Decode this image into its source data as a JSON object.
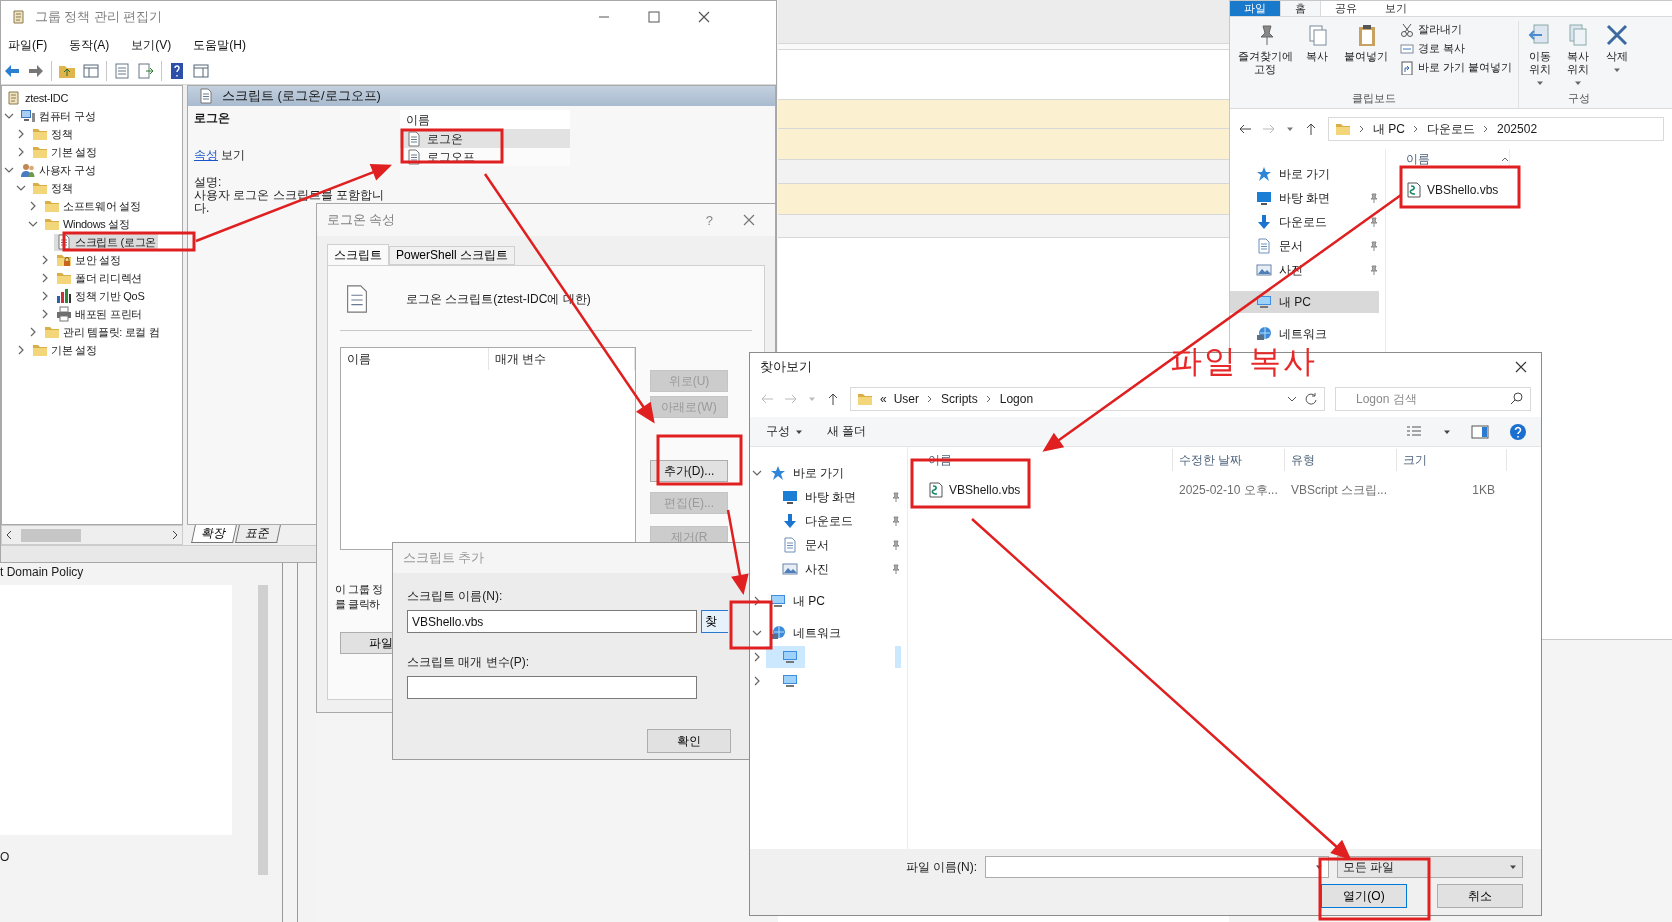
{
  "gpe": {
    "title": "그룹 정책 관리 편집기",
    "menu": [
      "파일(F)",
      "동작(A)",
      "보기(V)",
      "도움말(H)"
    ],
    "tree_root": {
      "label": "ztest-IDC",
      "selected": false
    },
    "tree": [
      {
        "label": "컴퓨터 구성",
        "kind": "computer",
        "expanded": true,
        "selected": false,
        "children": [
          {
            "label": "정책",
            "kind": "folder",
            "expanded": false,
            "selected": false
          },
          {
            "label": "기본 설정",
            "kind": "folder",
            "expanded": false,
            "selected": false
          }
        ]
      },
      {
        "label": "사용자 구성",
        "kind": "users",
        "expanded": true,
        "selected": false,
        "children": [
          {
            "label": "정책",
            "kind": "folder",
            "expanded": true,
            "selected": false,
            "children": [
              {
                "label": "소프트웨어 설정",
                "kind": "folder",
                "expanded": false,
                "selected": false
              },
              {
                "label": "Windows 설정",
                "kind": "folder",
                "expanded": true,
                "selected": false,
                "children": [
                  {
                    "label": "스크립트 (로그온",
                    "kind": "script",
                    "selected": true
                  },
                  {
                    "label": "보안 설정",
                    "kind": "security",
                    "expanded": false,
                    "selected": false
                  },
                  {
                    "label": "폴더 리디렉션",
                    "kind": "folder",
                    "expanded": false,
                    "selected": false
                  },
                  {
                    "label": "정책 기반 QoS",
                    "kind": "qos",
                    "expanded": false,
                    "selected": false
                  },
                  {
                    "label": "배포된 프린터",
                    "kind": "printer",
                    "expanded": false,
                    "selected": false
                  }
                ]
              },
              {
                "label": "관리 템플릿: 로컬 컴",
                "kind": "folder",
                "expanded": false,
                "selected": false
              }
            ]
          },
          {
            "label": "기본 설정",
            "kind": "folder",
            "expanded": false,
            "selected": false
          }
        ]
      }
    ],
    "pane": {
      "header": "스크립트 (로그온/로그오프)",
      "heading": "로그온",
      "link": "속성",
      "link_suffix": "보기",
      "description_label": "설명:",
      "description": [
        "사용자 로그온 스크립트를 포함합니",
        "다."
      ],
      "list_column": "이름",
      "list_items": [
        {
          "label": "로그온",
          "selected": true
        },
        {
          "label": "로그오프",
          "selected": false
        }
      ]
    },
    "view_tabs": [
      {
        "label": "확장",
        "selected": true
      },
      {
        "label": "표준",
        "selected": false
      }
    ]
  },
  "backdrop": {
    "title": "t Domain Policy",
    "footer": "O"
  },
  "logon_dialog": {
    "title": "로그온 속성",
    "help": "?",
    "tabs": [
      {
        "label": "스크립트",
        "selected": true
      },
      {
        "label": "PowerShell 스크립트",
        "selected": false
      }
    ],
    "heading": "로그온 스크립트(ztest-IDC에 대한)",
    "columns": [
      "이름",
      "매개 변수"
    ],
    "buttons": [
      {
        "label": "위로(U)",
        "disabled": true
      },
      {
        "label": "아래로(W)",
        "disabled": true
      },
      {
        "label": "추가(D)...",
        "disabled": false
      },
      {
        "label": "편집(E)...",
        "disabled": true
      },
      {
        "label": "제거(R",
        "disabled": true
      }
    ],
    "note": [
      "이 그룹 정",
      "를 클릭하"
    ],
    "files_button": "파일"
  },
  "add_dialog": {
    "title": "스크립트 추가",
    "name_label": "스크립트 이름(N):",
    "name_value": "VBShello.vbs",
    "browse_button": "찾",
    "params_label": "스크립트 매개 변수(P):",
    "ok_button": "확인"
  },
  "browse_dialog": {
    "title": "찾아보기",
    "path_prefix": "«",
    "path": [
      "User",
      "Scripts",
      "Logon"
    ],
    "search_placeholder": "Logon 검색",
    "toolbar": [
      {
        "label": "구성",
        "menu": true
      },
      {
        "label": "새 폴더",
        "menu": false
      }
    ],
    "nav": [
      {
        "label": "바로 가기",
        "kind": "star",
        "expanded": true,
        "selected": false,
        "pinned": false,
        "children": [
          {
            "label": "바탕 화면",
            "kind": "desktop",
            "selected": false,
            "pinned": true
          },
          {
            "label": "다운로드",
            "kind": "download",
            "selected": false,
            "pinned": true
          },
          {
            "label": "문서",
            "kind": "document",
            "selected": false,
            "pinned": true
          },
          {
            "label": "사진",
            "kind": "pictures",
            "selected": false,
            "pinned": true
          }
        ]
      },
      {
        "label": "내 PC",
        "kind": "pc",
        "expanded": false,
        "selected": false,
        "pinned": false
      },
      {
        "label": "네트워크",
        "kind": "network",
        "expanded": true,
        "selected": false,
        "pinned": false,
        "children": [
          {
            "kind": "pc",
            "expanded": false,
            "selected": true,
            "pinned": false
          },
          {
            "kind": "pc",
            "expanded": false,
            "selected": false,
            "pinned": false
          }
        ]
      }
    ],
    "columns": [
      "이름",
      "수정한 날짜",
      "유형",
      "크기"
    ],
    "files": [
      {
        "name": "VBShello.vbs",
        "date": "2025-02-10 오후...",
        "type": "VBScript 스크립...",
        "size": "1KB"
      }
    ],
    "filename_label": "파일 이름(N):",
    "filter": "모든 파일",
    "buttons": [
      {
        "label": "열기(O)",
        "default": true
      },
      {
        "label": "취소",
        "default": false
      }
    ]
  },
  "explorer": {
    "ribbon_tabs": [
      {
        "label": "파일",
        "kind": "file",
        "selected": false
      },
      {
        "label": "홈",
        "kind": "tab",
        "selected": true
      },
      {
        "label": "공유",
        "kind": "tab",
        "selected": false
      },
      {
        "label": "보기",
        "kind": "tab",
        "selected": false
      }
    ],
    "clipboard": {
      "large": [
        {
          "label": "즐겨찾기에 고정",
          "kind": "pin"
        },
        {
          "label": "복사",
          "kind": "copy"
        },
        {
          "label": "붙여넣기",
          "kind": "paste"
        }
      ],
      "small": [
        {
          "label": "잘라내기",
          "kind": "cut"
        },
        {
          "label": "경로 복사",
          "kind": "path"
        },
        {
          "label": "바로 가기 붙여넣기",
          "kind": "shortcut"
        }
      ],
      "group": "클립보드"
    },
    "organize": {
      "buttons": [
        {
          "label": "이동 위치",
          "kind": "move",
          "menu": true
        },
        {
          "label": "복사 위치",
          "kind": "copyto",
          "menu": true
        },
        {
          "label": "삭제",
          "kind": "delete",
          "menu": true
        }
      ],
      "group": "구성"
    },
    "path": [
      "내 PC",
      "다운로드",
      "202502"
    ],
    "nav": [
      {
        "label": "바로 가기",
        "kind": "star",
        "selected": false,
        "pinned": false,
        "children": [
          {
            "label": "바탕 화면",
            "kind": "desktop",
            "selected": false,
            "pinned": true
          },
          {
            "label": "다운로드",
            "kind": "download",
            "selected": false,
            "pinned": true
          },
          {
            "label": "문서",
            "kind": "document",
            "selected": false,
            "pinned": true
          },
          {
            "label": "사진",
            "kind": "pictures",
            "selected": false,
            "pinned": true
          }
        ]
      },
      {
        "label": "내 PC",
        "kind": "pc",
        "selected": true,
        "pinned": false
      },
      {
        "label": "네트워크",
        "kind": "network",
        "selected": false,
        "pinned": false
      }
    ],
    "column": "이름",
    "files": [
      {
        "name": "VBShello.vbs"
      }
    ]
  },
  "annotation": {
    "text": "파일 복사"
  }
}
